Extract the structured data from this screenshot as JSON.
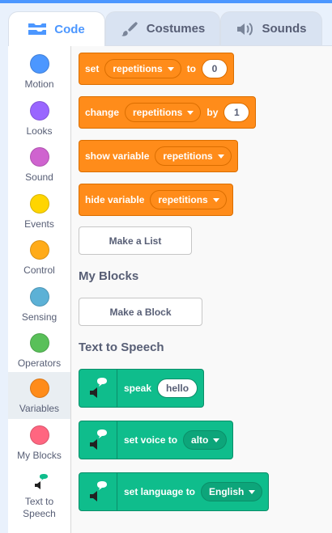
{
  "tabs": {
    "code": "Code",
    "costumes": "Costumes",
    "sounds": "Sounds"
  },
  "categories": [
    {
      "label": "Motion",
      "color": "#4c97ff"
    },
    {
      "label": "Looks",
      "color": "#9966ff"
    },
    {
      "label": "Sound",
      "color": "#cf63cf"
    },
    {
      "label": "Events",
      "color": "#ffd500"
    },
    {
      "label": "Control",
      "color": "#ffab19"
    },
    {
      "label": "Sensing",
      "color": "#5cb1d6"
    },
    {
      "label": "Operators",
      "color": "#59c059"
    },
    {
      "label": "Variables",
      "color": "#ff8c1a",
      "selected": true
    },
    {
      "label": "My Blocks",
      "color": "#ff6680"
    },
    {
      "label": "Text to Speech",
      "color": "#0fbd8c"
    }
  ],
  "variable_blocks": {
    "set": {
      "prefix": "set",
      "variable": "repetitions",
      "middle": "to",
      "value": "0"
    },
    "change": {
      "prefix": "change",
      "variable": "repetitions",
      "middle": "by",
      "value": "1"
    },
    "show": {
      "prefix": "show variable",
      "variable": "repetitions"
    },
    "hide": {
      "prefix": "hide variable",
      "variable": "repetitions"
    }
  },
  "make_list_button": "Make a List",
  "my_blocks": {
    "title": "My Blocks",
    "make_block_button": "Make a Block"
  },
  "text_to_speech": {
    "title": "Text to Speech",
    "speak": {
      "label": "speak",
      "value": "hello"
    },
    "set_voice": {
      "label": "set voice to",
      "value": "alto"
    },
    "set_language": {
      "label": "set language to",
      "value": "English"
    }
  }
}
